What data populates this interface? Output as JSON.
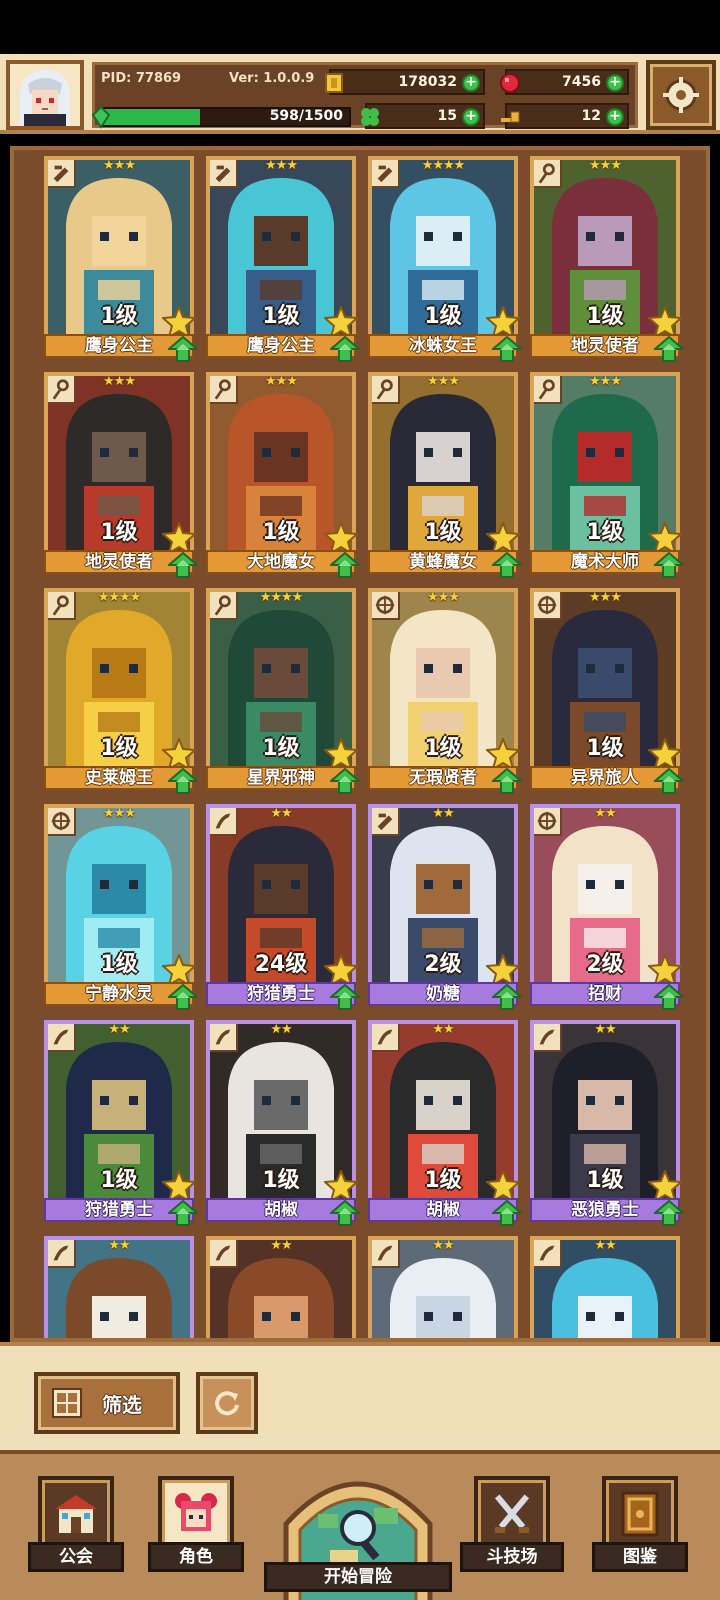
{
  "header": {
    "pid": "PID: 77869",
    "version": "Ver: 1.0.0.9",
    "gold": "178032",
    "gems": "7456",
    "exp_text": "598/1500",
    "exp_progress": 0.398,
    "clover": "15",
    "keys": "12"
  },
  "heroes": [
    {
      "level": "1级",
      "name": "鹰身公主",
      "stars": "★★★",
      "type": "scroll",
      "frame": "gold",
      "colors": [
        "#e8c98a",
        "#3d8a9a",
        "#f1d59a"
      ]
    },
    {
      "level": "1级",
      "name": "鹰身公主",
      "stars": "★★★",
      "type": "scroll",
      "frame": "gold",
      "colors": [
        "#49c6d6",
        "#365e88",
        "#5a3a2a"
      ]
    },
    {
      "level": "1级",
      "name": "冰蛛女王",
      "stars": "★★★★",
      "type": "scroll",
      "frame": "gold",
      "colors": [
        "#5cc6e4",
        "#2f6d98",
        "#dbeef5"
      ]
    },
    {
      "level": "1级",
      "name": "地灵使者",
      "stars": "★★★",
      "type": "staff",
      "frame": "gold",
      "colors": [
        "#7a2f3a",
        "#5f8f3a",
        "#b99ab8"
      ]
    },
    {
      "level": "1级",
      "name": "地灵使者",
      "stars": "★★★",
      "type": "staff",
      "frame": "gold",
      "colors": [
        "#2f2a2a",
        "#b83a2a",
        "#6d5a4a"
      ]
    },
    {
      "level": "1级",
      "name": "大地魔女",
      "stars": "★★★",
      "type": "staff",
      "frame": "gold",
      "colors": [
        "#b8562a",
        "#d9823a",
        "#6a3422"
      ]
    },
    {
      "level": "1级",
      "name": "黄蜂魔女",
      "stars": "★★★",
      "type": "staff",
      "frame": "gold",
      "colors": [
        "#2a2a36",
        "#e0a83a",
        "#d7d2cf"
      ]
    },
    {
      "level": "1级",
      "name": "魔术大师",
      "stars": "★★★",
      "type": "staff",
      "frame": "gold",
      "colors": [
        "#1f6a4a",
        "#6ac0a0",
        "#b52a2a"
      ]
    },
    {
      "level": "1级",
      "name": "史莱姆王",
      "stars": "★★★★",
      "type": "staff",
      "frame": "gold",
      "colors": [
        "#e2a82a",
        "#f5d046",
        "#b87a14"
      ]
    },
    {
      "level": "1级",
      "name": "星界邪神",
      "stars": "★★★★",
      "type": "staff",
      "frame": "gold",
      "colors": [
        "#1f4a3a",
        "#3a8a66",
        "#6a4a3a"
      ]
    },
    {
      "level": "1级",
      "name": "无瑕贤者",
      "stars": "★★★",
      "type": "cross",
      "frame": "gold",
      "colors": [
        "#f2e6c6",
        "#f0d070",
        "#e9c9b0"
      ]
    },
    {
      "level": "1级",
      "name": "异界旅人",
      "stars": "★★★",
      "type": "cross",
      "frame": "gold",
      "colors": [
        "#2a2a3e",
        "#7a4a2a",
        "#3a4a6a"
      ]
    },
    {
      "level": "1级",
      "name": "宁静水灵",
      "stars": "★★★",
      "type": "cross",
      "frame": "gold",
      "colors": [
        "#5ad2e6",
        "#a0ecf4",
        "#2a8aa8"
      ]
    },
    {
      "level": "24级",
      "name": "狩猎勇士",
      "stars": "★★",
      "type": "claw",
      "frame": "purple",
      "colors": [
        "#2a2a3a",
        "#c44a2a",
        "#5a3a2a"
      ]
    },
    {
      "level": "2级",
      "name": "奶糖",
      "stars": "★★",
      "type": "scroll",
      "frame": "purple",
      "colors": [
        "#dde4ee",
        "#3a4a6a",
        "#a06a3a"
      ]
    },
    {
      "level": "2级",
      "name": "招财",
      "stars": "★★",
      "type": "cross",
      "frame": "purple",
      "colors": [
        "#f2e2c8",
        "#e86a8a",
        "#f5f0ea"
      ]
    },
    {
      "level": "1级",
      "name": "狩猎勇士",
      "stars": "★★",
      "type": "claw",
      "frame": "purple",
      "colors": [
        "#1f2a4a",
        "#4a8a3a",
        "#c8b07a"
      ]
    },
    {
      "level": "1级",
      "name": "胡椒",
      "stars": "★★",
      "type": "claw",
      "frame": "purple",
      "colors": [
        "#e8e4e0",
        "#2a2a2a",
        "#6a6a6a"
      ]
    },
    {
      "level": "1级",
      "name": "胡椒",
      "stars": "★★",
      "type": "claw",
      "frame": "purple",
      "colors": [
        "#2a2a2a",
        "#e04a3a",
        "#d8d2ca"
      ]
    },
    {
      "level": "1级",
      "name": "恶狼勇士",
      "stars": "★★",
      "type": "claw",
      "frame": "purple",
      "colors": [
        "#1f1f2a",
        "#3a3a4a",
        "#d8b8a8"
      ]
    },
    {
      "level": "",
      "name": "",
      "stars": "★★",
      "type": "claw",
      "frame": "purple",
      "colors": [
        "#7a4a2a",
        "#4ab0d8",
        "#f2ece0"
      ]
    },
    {
      "level": "",
      "name": "",
      "stars": "★★",
      "type": "claw",
      "frame": "gold",
      "colors": [
        "#8a4a2a",
        "#6a3a2a",
        "#d89a6a"
      ]
    },
    {
      "level": "",
      "name": "",
      "stars": "★★",
      "type": "claw",
      "frame": "gold",
      "colors": [
        "#e8eef4",
        "#7aa0c0",
        "#c8d6e4"
      ]
    },
    {
      "level": "",
      "name": "",
      "stars": "★★",
      "type": "claw",
      "frame": "gold",
      "colors": [
        "#4ac0e0",
        "#2a6a9a",
        "#e8f2f8"
      ]
    }
  ],
  "controls": {
    "filter_label": "筛选"
  },
  "nav": {
    "guild": "公会",
    "characters": "角色",
    "adventure": "开始冒险",
    "arena": "斗技场",
    "codex": "图鉴"
  }
}
